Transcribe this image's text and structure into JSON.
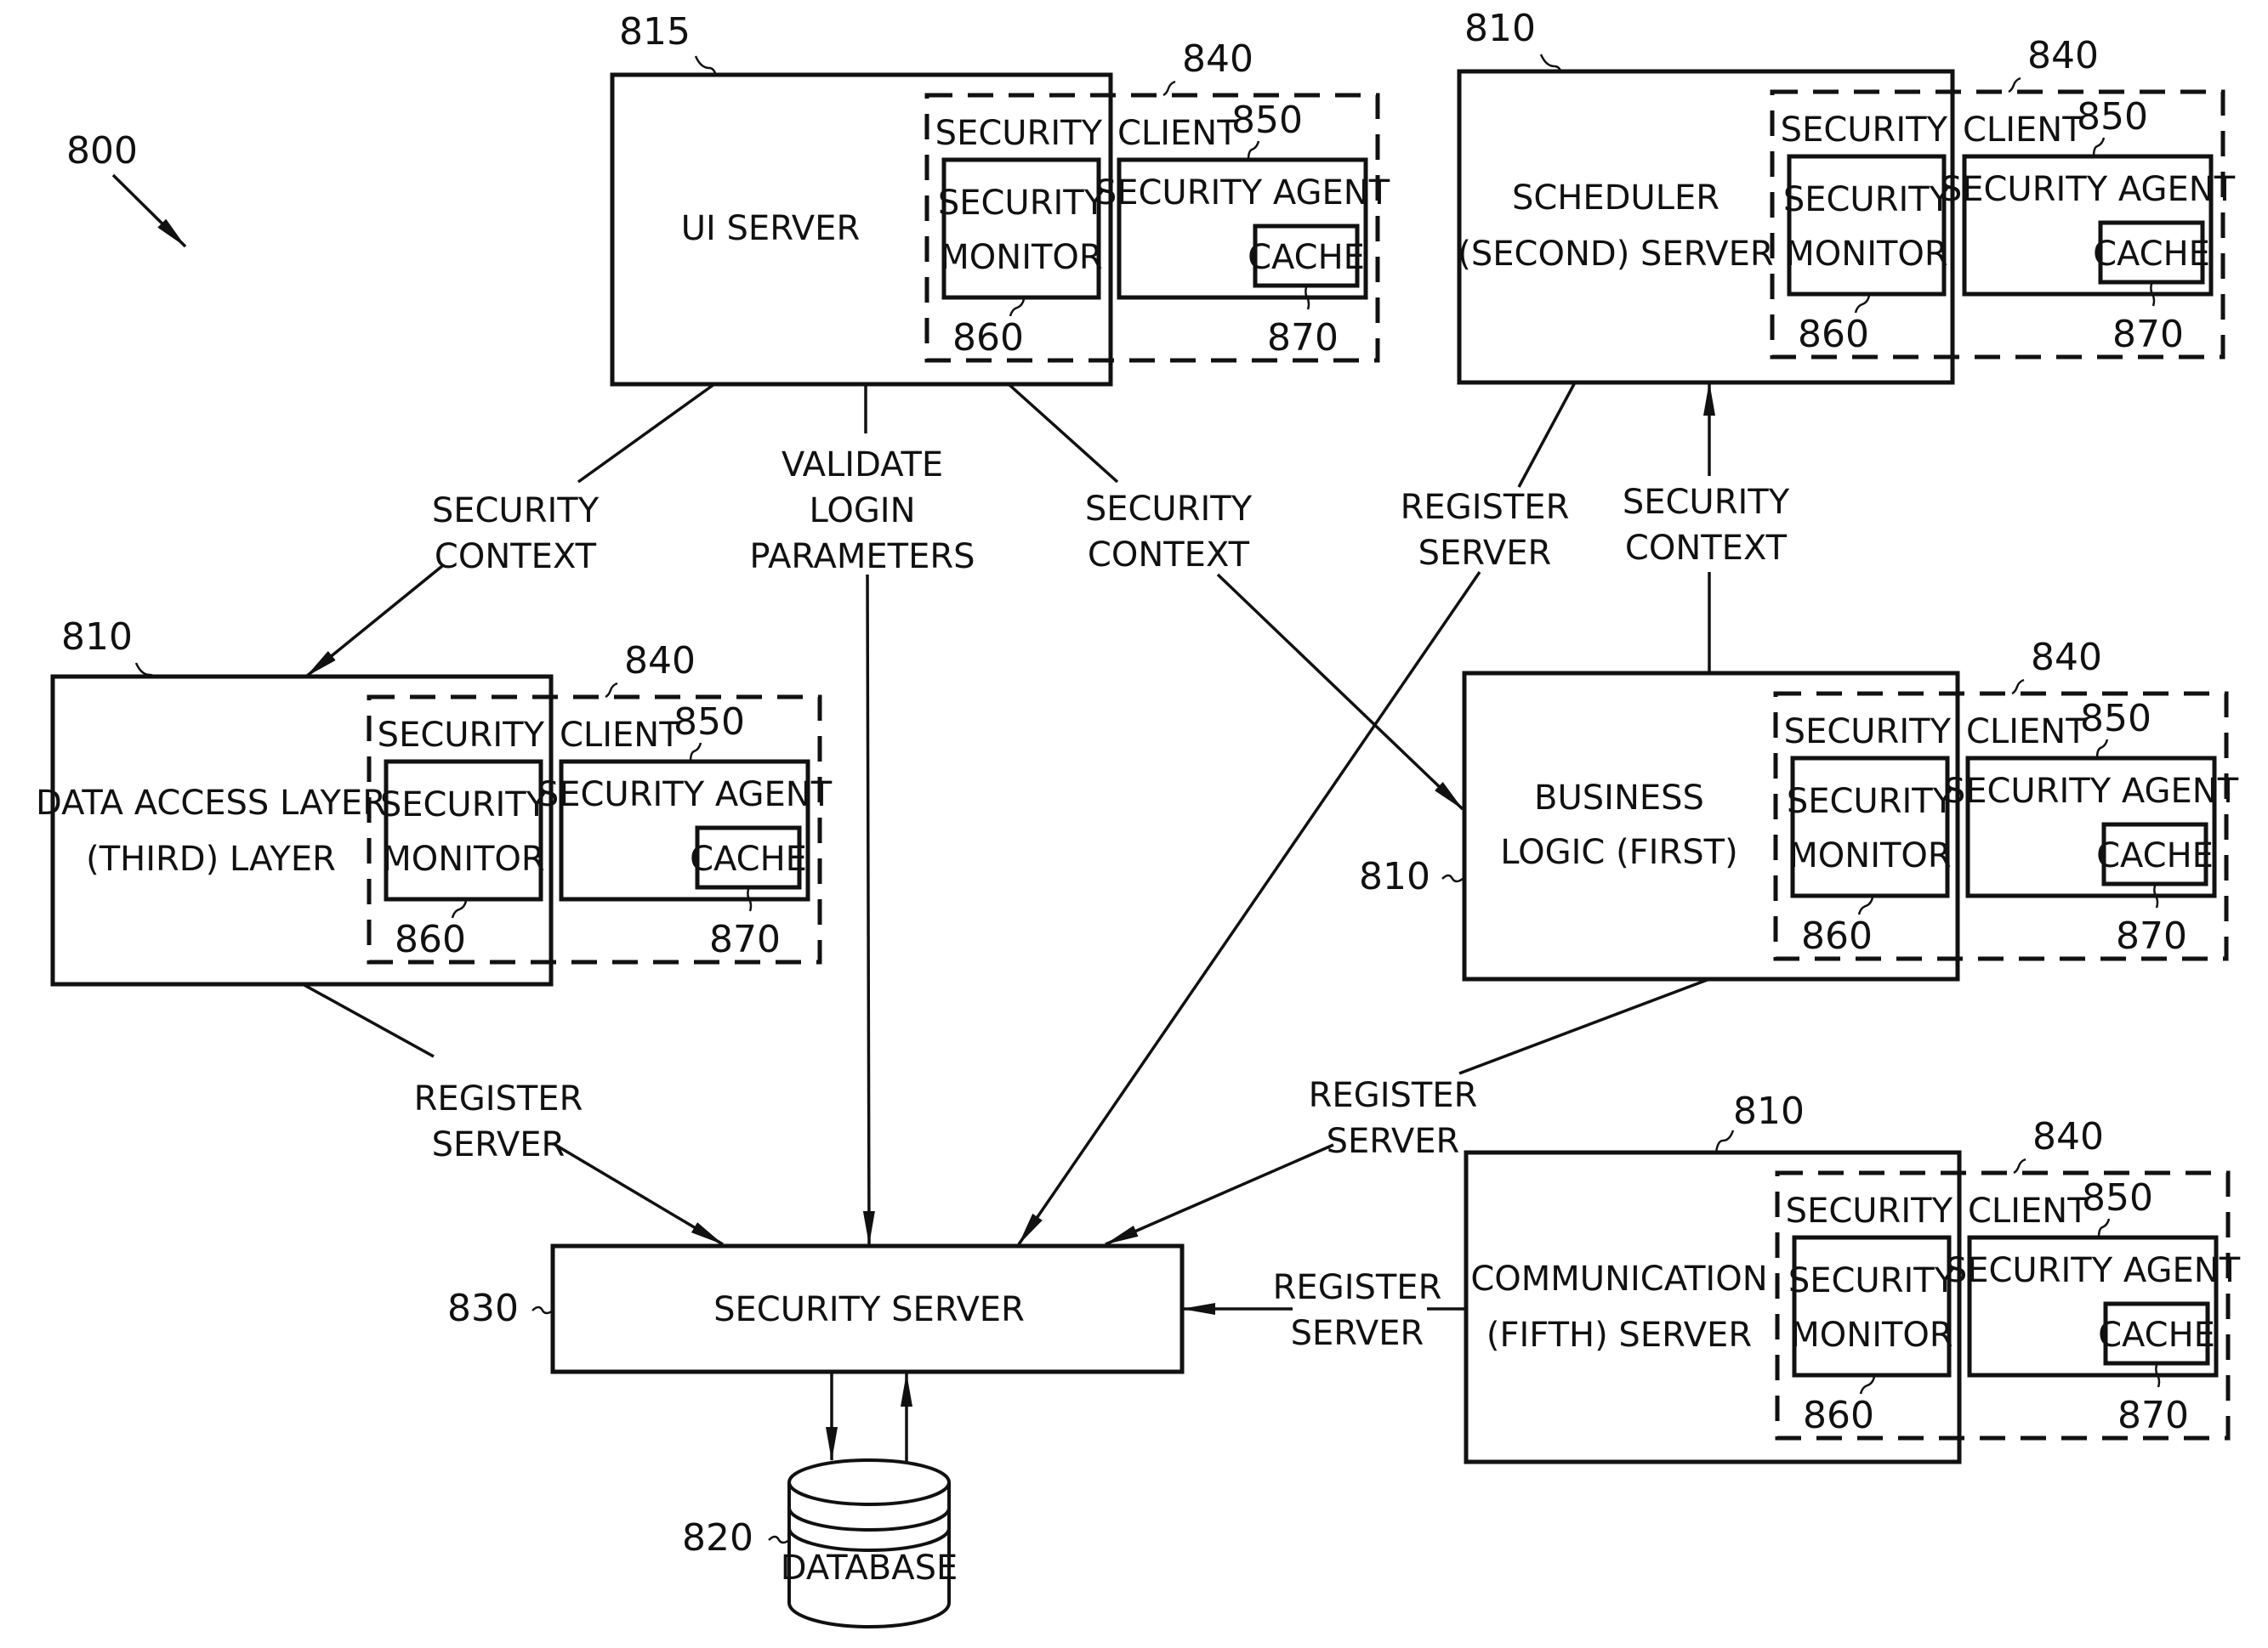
{
  "figure": {
    "ref": "800",
    "nodes": {
      "ui_server": {
        "ref": "815",
        "label": [
          "UI SERVER"
        ]
      },
      "scheduler": {
        "ref": "810",
        "label": [
          "SCHEDULER",
          "(SECOND) SERVER"
        ]
      },
      "data_access": {
        "ref": "810",
        "label": [
          "DATA ACCESS LAYER",
          "(THIRD) LAYER"
        ]
      },
      "business_logic": {
        "ref": "810",
        "label": [
          "BUSINESS",
          "LOGIC (FIRST)"
        ]
      },
      "communication": {
        "ref": "810",
        "label": [
          "COMMUNICATION",
          "(FIFTH) SERVER"
        ]
      },
      "security_server": {
        "ref": "830",
        "label": [
          "SECURITY SERVER"
        ]
      },
      "database": {
        "ref": "820",
        "label": [
          "DATABASE"
        ]
      }
    },
    "security_client": {
      "ref": "840",
      "label_left": "SECURITY",
      "label_right": "CLIENT",
      "monitor": {
        "ref": "860",
        "label": [
          "SECURITY",
          "MONITOR"
        ]
      },
      "agent": {
        "ref": "850",
        "label": "SECURITY AGENT"
      },
      "cache": {
        "ref": "870",
        "label": "CACHE"
      }
    },
    "edges": [
      {
        "from": "ui_server",
        "to": "data_access",
        "label": [
          "SECURITY",
          "CONTEXT"
        ]
      },
      {
        "from": "ui_server",
        "to": "security_server",
        "label": [
          "VALIDATE",
          "LOGIN",
          "PARAMETERS"
        ]
      },
      {
        "from": "ui_server",
        "to": "business_logic",
        "label": [
          "SECURITY",
          "CONTEXT"
        ]
      },
      {
        "from": "scheduler",
        "to": "security_server",
        "label": [
          "REGISTER",
          "SERVER"
        ]
      },
      {
        "from": "business_logic",
        "to": "scheduler",
        "label": [
          "SECURITY",
          "CONTEXT"
        ]
      },
      {
        "from": "data_access",
        "to": "security_server",
        "label": [
          "REGISTER",
          "SERVER"
        ]
      },
      {
        "from": "business_logic",
        "to": "security_server",
        "label": [
          "REGISTER",
          "SERVER"
        ]
      },
      {
        "from": "communication",
        "to": "security_server",
        "label": [
          "REGISTER",
          "SERVER"
        ]
      },
      {
        "from": "security_server",
        "to": "database",
        "label": []
      },
      {
        "from": "database",
        "to": "security_server",
        "label": []
      }
    ]
  }
}
